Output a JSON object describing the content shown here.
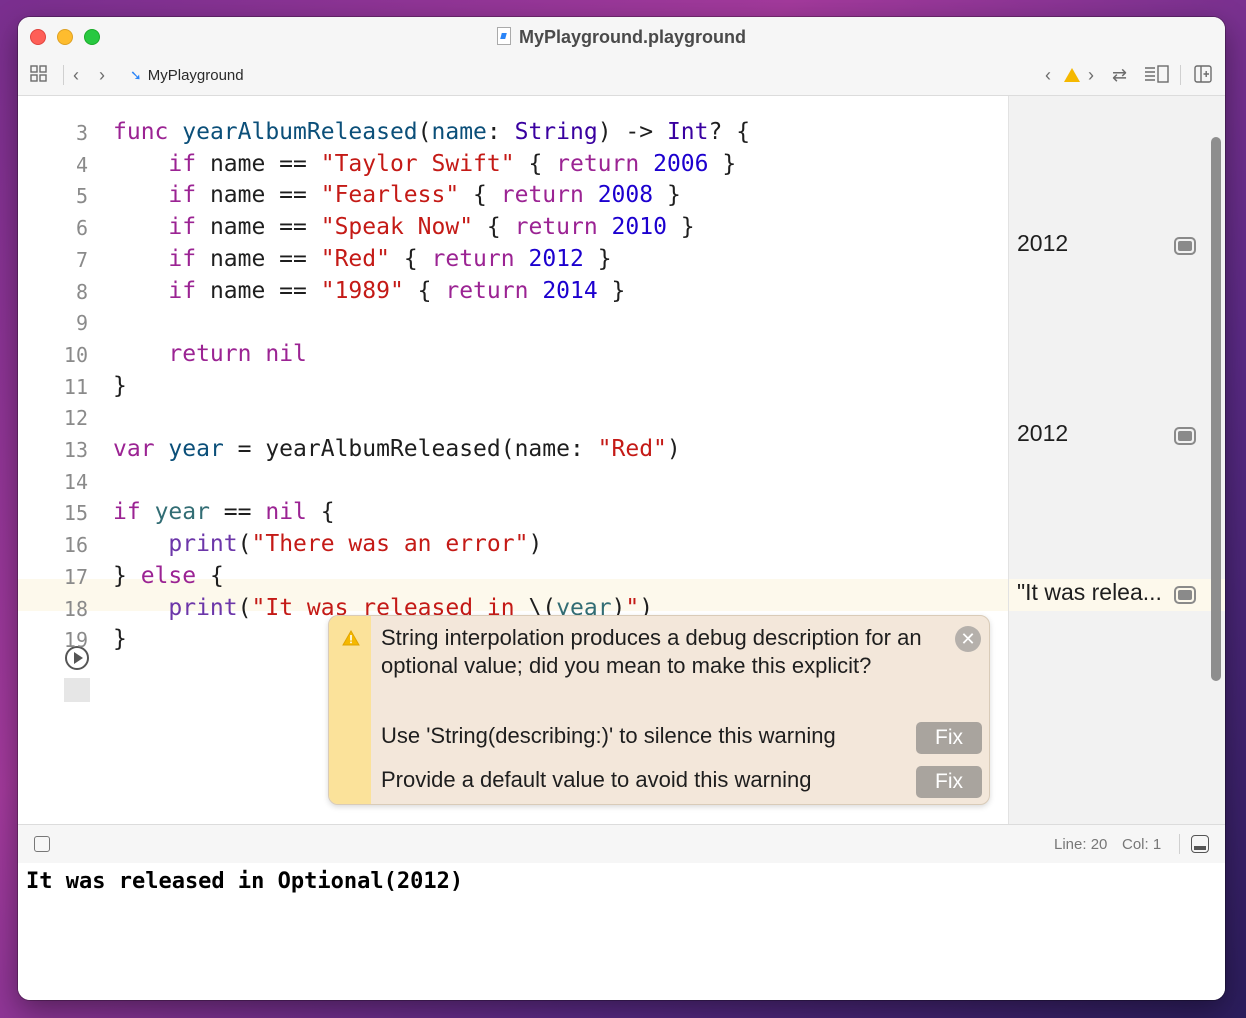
{
  "window": {
    "title": "MyPlayground.playground",
    "file_icon": "playground-file-icon"
  },
  "toolbar": {
    "breadcrumb": "MyPlayground"
  },
  "code": {
    "lines": [
      {
        "n": "3",
        "tokens": [
          [
            "kw",
            "func"
          ],
          [
            "nm",
            " "
          ],
          [
            "ty",
            "yearAlbumReleased"
          ],
          [
            "nm",
            "("
          ],
          [
            "ty",
            "name"
          ],
          [
            "nm",
            ": "
          ],
          [
            "tyn",
            "String"
          ],
          [
            "nm",
            ") -> "
          ],
          [
            "tyn",
            "Int"
          ],
          [
            "nm",
            "? {"
          ]
        ]
      },
      {
        "n": "4",
        "tokens": [
          [
            "nm",
            "    "
          ],
          [
            "kw",
            "if"
          ],
          [
            "nm",
            " name == "
          ],
          [
            "str",
            "\"Taylor Swift\""
          ],
          [
            "nm",
            " { "
          ],
          [
            "kw",
            "return"
          ],
          [
            "nm",
            " "
          ],
          [
            "num",
            "2006"
          ],
          [
            "nm",
            " }"
          ]
        ]
      },
      {
        "n": "5",
        "tokens": [
          [
            "nm",
            "    "
          ],
          [
            "kw",
            "if"
          ],
          [
            "nm",
            " name == "
          ],
          [
            "str",
            "\"Fearless\""
          ],
          [
            "nm",
            " { "
          ],
          [
            "kw",
            "return"
          ],
          [
            "nm",
            " "
          ],
          [
            "num",
            "2008"
          ],
          [
            "nm",
            " }"
          ]
        ]
      },
      {
        "n": "6",
        "tokens": [
          [
            "nm",
            "    "
          ],
          [
            "kw",
            "if"
          ],
          [
            "nm",
            " name == "
          ],
          [
            "str",
            "\"Speak Now\""
          ],
          [
            "nm",
            " { "
          ],
          [
            "kw",
            "return"
          ],
          [
            "nm",
            " "
          ],
          [
            "num",
            "2010"
          ],
          [
            "nm",
            " }"
          ]
        ]
      },
      {
        "n": "7",
        "tokens": [
          [
            "nm",
            "    "
          ],
          [
            "kw",
            "if"
          ],
          [
            "nm",
            " name == "
          ],
          [
            "str",
            "\"Red\""
          ],
          [
            "nm",
            " { "
          ],
          [
            "kw",
            "return"
          ],
          [
            "nm",
            " "
          ],
          [
            "num",
            "2012"
          ],
          [
            "nm",
            " }"
          ]
        ]
      },
      {
        "n": "8",
        "tokens": [
          [
            "nm",
            "    "
          ],
          [
            "kw",
            "if"
          ],
          [
            "nm",
            " name == "
          ],
          [
            "str",
            "\"1989\""
          ],
          [
            "nm",
            " { "
          ],
          [
            "kw",
            "return"
          ],
          [
            "nm",
            " "
          ],
          [
            "num",
            "2014"
          ],
          [
            "nm",
            " }"
          ]
        ]
      },
      {
        "n": "9",
        "tokens": []
      },
      {
        "n": "10",
        "tokens": [
          [
            "nm",
            "    "
          ],
          [
            "kw",
            "return"
          ],
          [
            "nm",
            " "
          ],
          [
            "kw",
            "nil"
          ]
        ]
      },
      {
        "n": "11",
        "tokens": [
          [
            "nm",
            "}"
          ]
        ]
      },
      {
        "n": "12",
        "tokens": []
      },
      {
        "n": "13",
        "tokens": [
          [
            "kw",
            "var"
          ],
          [
            "nm",
            " "
          ],
          [
            "ty",
            "year"
          ],
          [
            "nm",
            " = yearAlbumReleased(name: "
          ],
          [
            "str",
            "\"Red\""
          ],
          [
            "nm",
            ")"
          ]
        ]
      },
      {
        "n": "14",
        "tokens": []
      },
      {
        "n": "15",
        "tokens": [
          [
            "kw",
            "if"
          ],
          [
            "nm",
            " "
          ],
          [
            "var",
            "year"
          ],
          [
            "nm",
            " == "
          ],
          [
            "kw",
            "nil"
          ],
          [
            "nm",
            " {"
          ]
        ]
      },
      {
        "n": "16",
        "tokens": [
          [
            "nm",
            "    "
          ],
          [
            "fn",
            "print"
          ],
          [
            "nm",
            "("
          ],
          [
            "str",
            "\"There was an error\""
          ],
          [
            "nm",
            ")"
          ]
        ]
      },
      {
        "n": "17",
        "tokens": [
          [
            "nm",
            "} "
          ],
          [
            "kw",
            "else"
          ],
          [
            "nm",
            " {"
          ]
        ]
      },
      {
        "n": "18",
        "tokens": [
          [
            "nm",
            "    "
          ],
          [
            "fn",
            "print"
          ],
          [
            "nm",
            "("
          ],
          [
            "str",
            "\"It was released in "
          ],
          [
            "nm",
            "\\("
          ],
          [
            "var",
            "year"
          ],
          [
            "nm",
            ")"
          ],
          [
            "str",
            "\""
          ],
          [
            "nm",
            ")"
          ]
        ]
      },
      {
        "n": "19",
        "tokens": [
          [
            "nm",
            "}"
          ]
        ]
      }
    ],
    "highlighted_line": "18"
  },
  "results": {
    "line7": "2012",
    "line13": "2012",
    "line18": "\"It was relea..."
  },
  "warning_popover": {
    "message": "String interpolation produces a debug description for an optional value; did you mean to make this explicit?",
    "fixes": [
      {
        "text": "Use 'String(describing:)' to silence this warning",
        "button": "Fix"
      },
      {
        "text": "Provide a default value to avoid this warning",
        "button": "Fix"
      }
    ]
  },
  "statusbar": {
    "line": "Line: 20",
    "col": "Col: 1"
  },
  "console": {
    "output": "It was released in Optional(2012)"
  },
  "colors": {
    "keyword": "#9b2393",
    "string": "#c41a16",
    "number": "#1c00cf",
    "warning": "#f5b800"
  }
}
